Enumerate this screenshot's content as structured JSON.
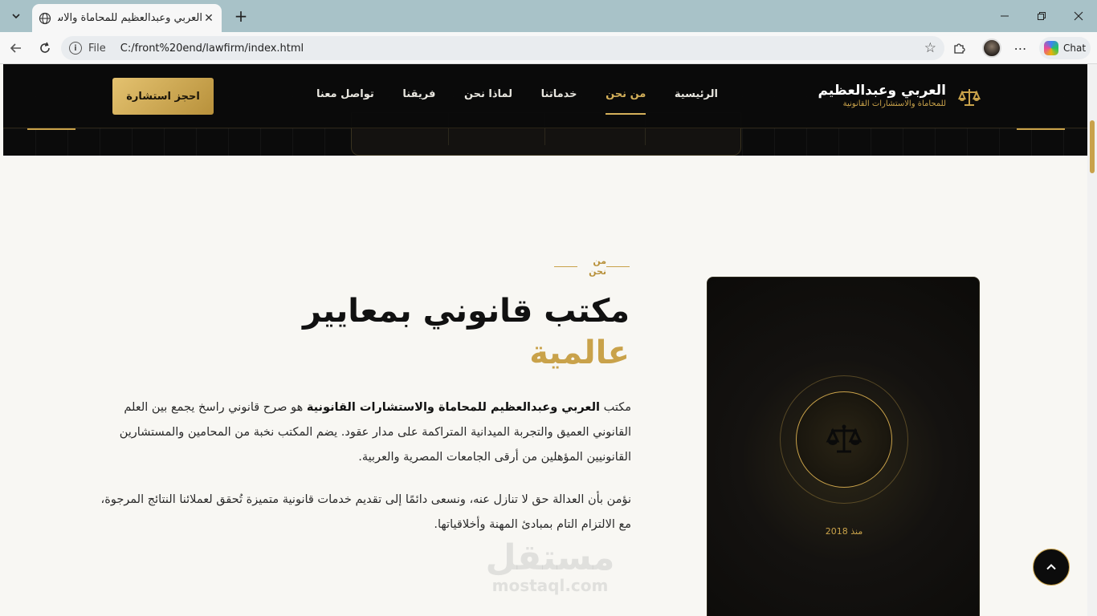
{
  "browser": {
    "tab_title": "العربي وعبدالعظيم للمحاماة والاستشارات القانونية",
    "url_scheme": "File",
    "url": "C:/front%20end/lawfirm/index.html",
    "chat_label": "Chat"
  },
  "nav": {
    "brand_name": "العربي وعبدالعظيم",
    "brand_sub": "للمحاماة والاستشارات القانونية",
    "links": [
      "الرئيسية",
      "من نحن",
      "خدماتنا",
      "لماذا نحن",
      "فريقنا",
      "تواصل معنا"
    ],
    "active_index": 1,
    "cta_label": "احجز استشارة"
  },
  "about": {
    "label": "من نحن",
    "heading_line1": "مكتب قانوني بمعايير",
    "heading_line2": "عالمية",
    "p1_prefix": "مكتب",
    "p1_bold": "العربي وعبدالعظيم للمحاماة والاستشارات القانونية",
    "p1_rest": "هو صرح قانوني راسخ يجمع بين العلم القانوني العميق والتجربة الميدانية المتراكمة على مدار عقود. يضم المكتب نخبة من المحامين والمستشارين القانونيين المؤهلين من أرقى الجامعات المصرية والعربية.",
    "p2": "نؤمن بأن العدالة حق لا تنازل عنه، ونسعى دائمًا إلى تقديم خدمات قانونية متميزة تُحقق لعملائنا النتائج المرجوة، مع الالتزام التام بمبادئ المهنة وأخلاقياتها.",
    "since": "منذ 2018"
  },
  "watermark": {
    "ar": "مستقل",
    "en": "mostaql.com"
  },
  "colors": {
    "gold": "#c9a24a",
    "dark": "#0b0b0b"
  },
  "icons": {
    "brand": "scales-icon",
    "card": "scales-icon",
    "to_top": "chevron-up-icon"
  }
}
